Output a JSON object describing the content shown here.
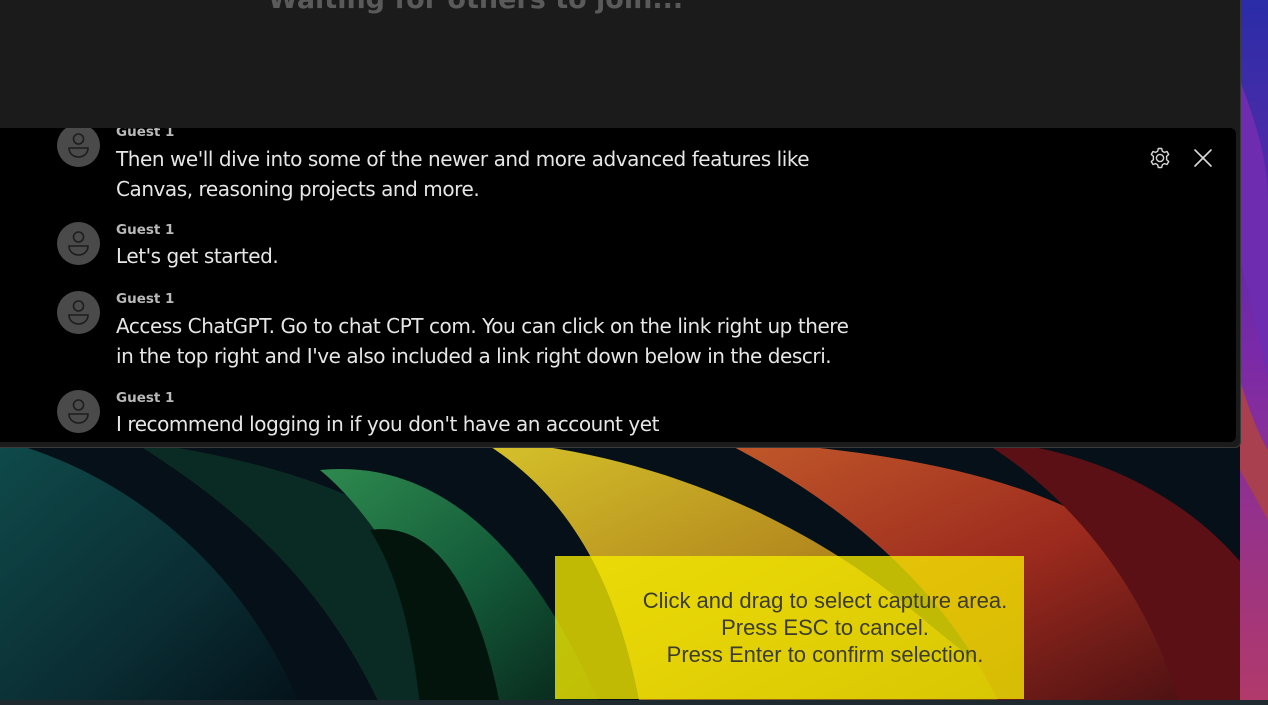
{
  "meeting": {
    "status_text": "Waiting for others to join..."
  },
  "captions": {
    "entries": [
      {
        "speaker": "Guest 1",
        "text": "Then we'll dive into some of the newer and more advanced features like Canvas, reasoning projects and more."
      },
      {
        "speaker": "Guest 1",
        "text": "Let's get started."
      },
      {
        "speaker": "Guest 1",
        "text": "Access ChatGPT. Go to chat CPT com. You can click on the link right up there in the top right and I've also included a link right down below in the descri."
      },
      {
        "speaker": "Guest 1",
        "text": "I recommend logging in if you don't have an account yet"
      }
    ],
    "settings_icon": "gear-icon",
    "close_icon": "close-icon"
  },
  "capture_overlay": {
    "line1": "Click and drag to select capture area.",
    "line2": "Press ESC to cancel.",
    "line3": "Press Enter to confirm selection."
  },
  "colors": {
    "caption_bg": "#000000",
    "window_bg": "#1b1b1b",
    "capture_overlay": "#f5eb00"
  }
}
